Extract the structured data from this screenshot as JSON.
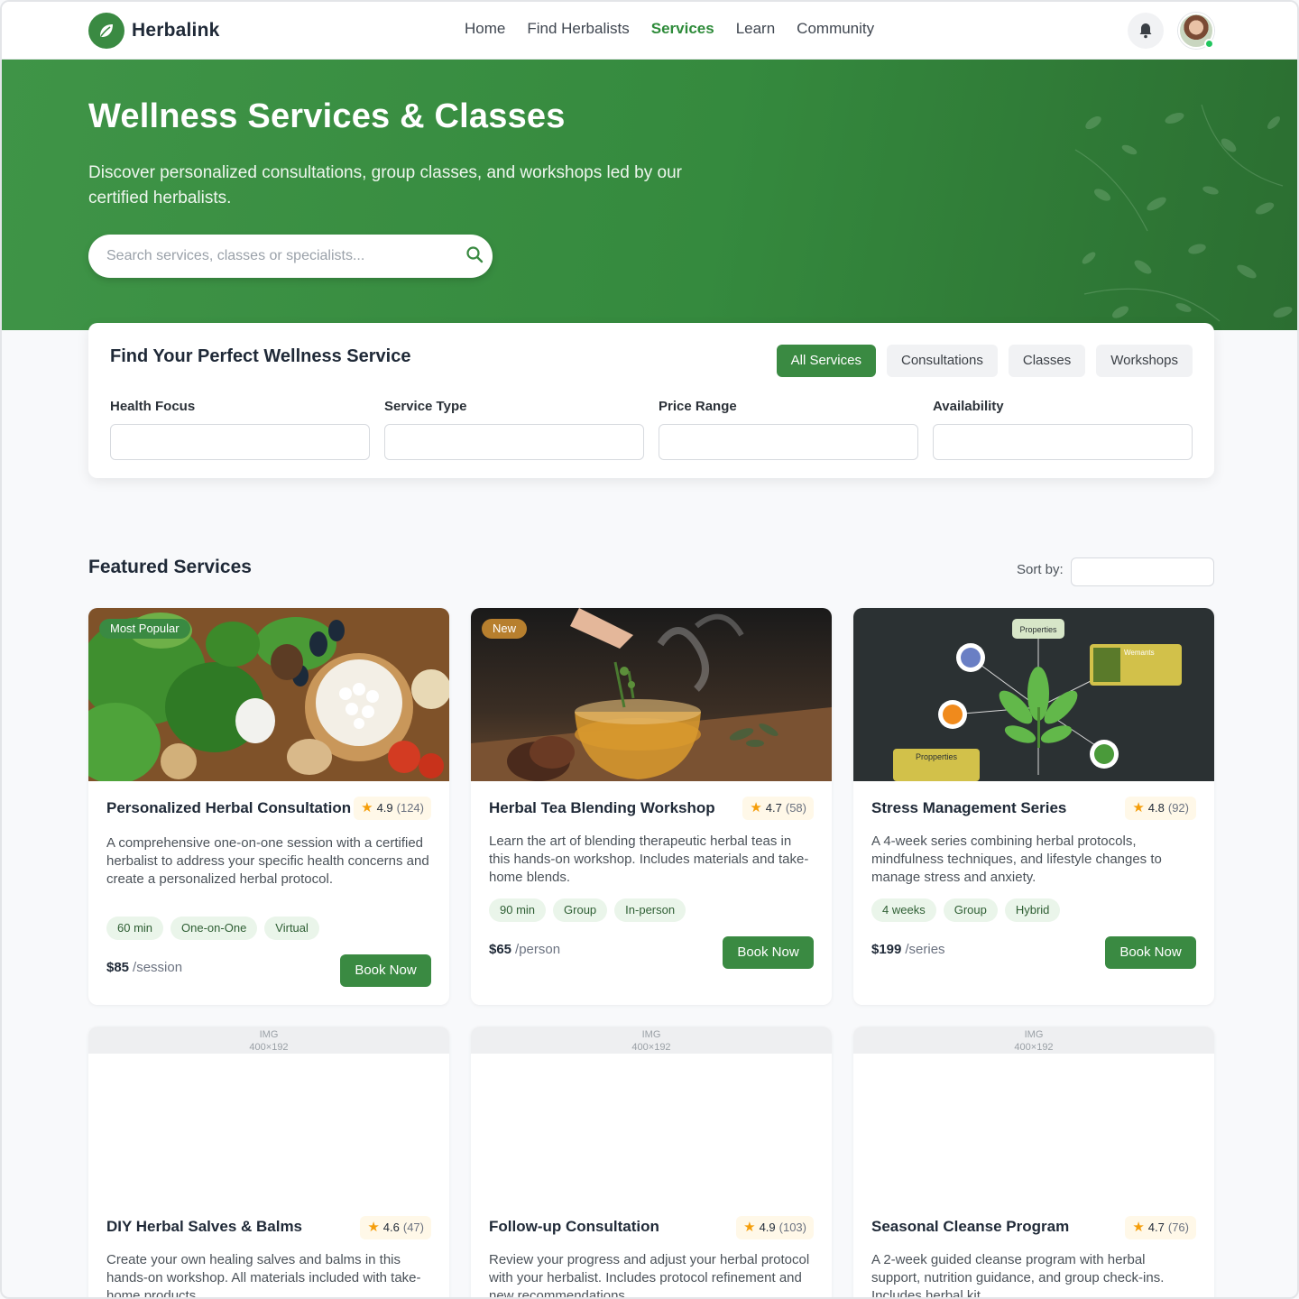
{
  "brand": {
    "name": "Herbalink",
    "accent": "#3a8a42"
  },
  "nav": {
    "links": [
      {
        "label": "Home"
      },
      {
        "label": "Find Herbalists"
      },
      {
        "label": "Services",
        "active": true
      },
      {
        "label": "Learn"
      },
      {
        "label": "Community"
      }
    ],
    "bell_icon": "bell-icon",
    "avatar_online": true
  },
  "hero": {
    "title": "Wellness Services & Classes",
    "subtitle": "Discover personalized consultations, group classes, and workshops led by our certified herbalists.",
    "search_placeholder": "Search services, classes or specialists..."
  },
  "filters": {
    "title": "Find Your Perfect Wellness Service",
    "tabs": [
      {
        "label": "All Services",
        "active": true
      },
      {
        "label": "Consultations"
      },
      {
        "label": "Classes"
      },
      {
        "label": "Workshops"
      }
    ],
    "fields": [
      {
        "label": "Health Focus",
        "value": ""
      },
      {
        "label": "Service Type",
        "value": ""
      },
      {
        "label": "Price Range",
        "value": ""
      },
      {
        "label": "Availability",
        "value": ""
      }
    ]
  },
  "featured": {
    "title": "Featured Services",
    "sort_label": "Sort by:",
    "sort_value": ""
  },
  "services": [
    {
      "badge": "Most Popular",
      "title": "Personalized Herbal Consultation",
      "rating": "4.9",
      "reviews": "(124)",
      "description": "A comprehensive one-on-one session with a certified herbalist to address your specific health concerns and create a personalized herbal protocol.",
      "tags": [
        "60 min",
        "One-on-One",
        "Virtual"
      ],
      "price": "$85",
      "unit": "/session",
      "cta": "Book Now"
    },
    {
      "badge": "New",
      "title": "Herbal Tea Blending Workshop",
      "rating": "4.7",
      "reviews": "(58)",
      "description": "Learn the art of blending therapeutic herbal teas in this hands-on workshop. Includes materials and take-home blends.",
      "tags": [
        "90 min",
        "Group",
        "In-person"
      ],
      "price": "$65",
      "unit": "/person",
      "cta": "Book Now"
    },
    {
      "title": "Stress Management Series",
      "rating": "4.8",
      "reviews": "(92)",
      "description": "A 4-week series combining herbal protocols, mindfulness techniques, and lifestyle changes to manage stress and anxiety.",
      "tags": [
        "4 weeks",
        "Group",
        "Hybrid"
      ],
      "price": "$199",
      "unit": "/series",
      "cta": "Book Now",
      "image_labels": {
        "top": "Properties",
        "box": "Wemants",
        "bottom": "Propperties"
      }
    },
    {
      "placeholder": "IMG\n400×192",
      "title": "DIY Herbal Salves & Balms",
      "rating": "4.6",
      "reviews": "(47)",
      "description": "Create your own healing salves and balms in this hands-on workshop. All materials included with take-home products."
    },
    {
      "placeholder": "IMG\n400×192",
      "title": "Follow-up Consultation",
      "rating": "4.9",
      "reviews": "(103)",
      "description": "Review your progress and adjust your herbal protocol with your herbalist. Includes protocol refinement and new recommendations."
    },
    {
      "placeholder": "IMG\n400×192",
      "title": "Seasonal Cleanse Program",
      "rating": "4.7",
      "reviews": "(76)",
      "description": "A 2-week guided cleanse program with herbal support, nutrition guidance, and group check-ins. Includes herbal kit."
    }
  ]
}
